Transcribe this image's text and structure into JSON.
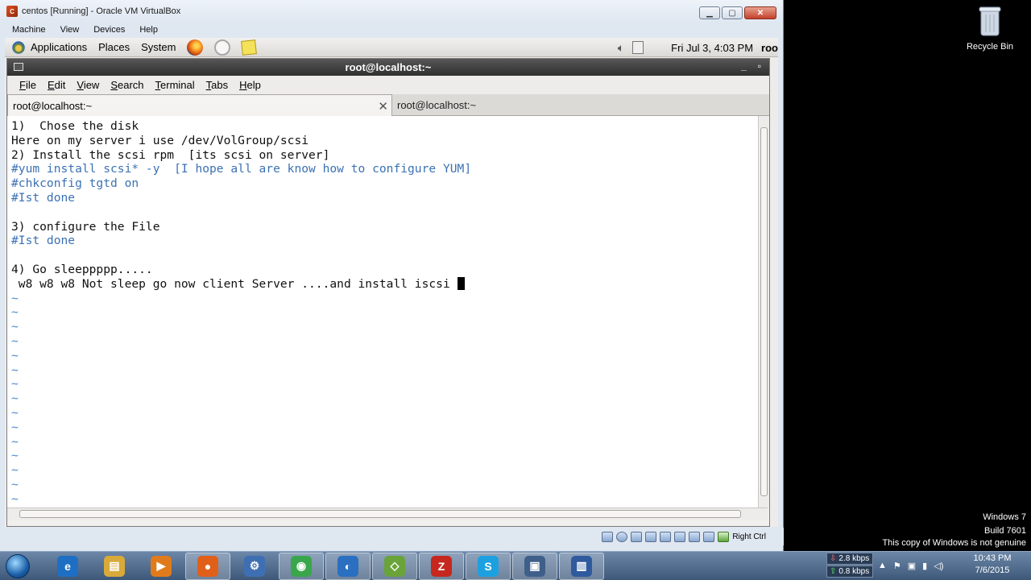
{
  "vbox": {
    "title": "centos [Running] - Oracle VM VirtualBox",
    "menu": [
      "Machine",
      "View",
      "Devices",
      "Help"
    ],
    "status_text": "Right Ctrl"
  },
  "gnome_panel": {
    "applications": "Applications",
    "places": "Places",
    "system": "System",
    "datetime": "Fri Jul  3,  4:03 PM",
    "user": "roo"
  },
  "terminal": {
    "title": "root@localhost:~",
    "menu": [
      {
        "label": "File",
        "u": "F",
        "rest": "ile"
      },
      {
        "label": "Edit",
        "u": "E",
        "rest": "dit"
      },
      {
        "label": "View",
        "u": "V",
        "rest": "iew"
      },
      {
        "label": "Search",
        "u": "S",
        "rest": "earch"
      },
      {
        "label": "Terminal",
        "u": "T",
        "rest": "erminal"
      },
      {
        "label": "Tabs",
        "u": "T",
        "rest": "abs"
      },
      {
        "label": "Help",
        "u": "H",
        "rest": "elp"
      }
    ],
    "tabs": [
      "root@localhost:~",
      "root@localhost:~"
    ],
    "lines": [
      {
        "text": "1)  Chose the disk",
        "style": "black"
      },
      {
        "text": "Here on my server i use /dev/VolGroup/scsi",
        "style": "black"
      },
      {
        "text": "2) Install the scsi rpm  [its scsi on server]",
        "style": "black"
      },
      {
        "text": "#yum install scsi* -y  [I hope all are know how to configure YUM]",
        "style": "blue"
      },
      {
        "text": "#chkconfig tgtd on",
        "style": "blue"
      },
      {
        "text": "#Ist done",
        "style": "blue"
      },
      {
        "text": "",
        "style": "black"
      },
      {
        "text": "3) configure the File",
        "style": "black"
      },
      {
        "text": "#Ist done",
        "style": "blue"
      },
      {
        "text": "",
        "style": "black"
      },
      {
        "text": "4) Go sleeppppp.....",
        "style": "black"
      },
      {
        "text": " w8 w8 w8 Not sleep go now client Server ....and install iscsi ",
        "style": "black",
        "cursor": true
      },
      {
        "text": "~",
        "style": "tilde"
      },
      {
        "text": "~",
        "style": "tilde"
      },
      {
        "text": "~",
        "style": "tilde"
      },
      {
        "text": "~",
        "style": "tilde"
      },
      {
        "text": "~",
        "style": "tilde"
      },
      {
        "text": "~",
        "style": "tilde"
      },
      {
        "text": "~",
        "style": "tilde"
      },
      {
        "text": "~",
        "style": "tilde"
      },
      {
        "text": "~",
        "style": "tilde"
      },
      {
        "text": "~",
        "style": "tilde"
      },
      {
        "text": "~",
        "style": "tilde"
      },
      {
        "text": "~",
        "style": "tilde"
      },
      {
        "text": "~",
        "style": "tilde"
      },
      {
        "text": "~",
        "style": "tilde"
      },
      {
        "text": "~",
        "style": "tilde"
      },
      {
        "text": "~",
        "style": "tilde"
      }
    ]
  },
  "desktop": {
    "recycle_bin": "Recycle Bin",
    "genuine": [
      "Windows 7",
      "Build 7601",
      "This copy of Windows is not genuine"
    ]
  },
  "taskbar": {
    "net_down": "2.8 kbps",
    "net_up": "0.8 kbps",
    "time": "10:43 PM",
    "date": "7/6/2015",
    "apps": [
      {
        "name": "ie-icon",
        "color": "#1e6fc4",
        "glyph": "e"
      },
      {
        "name": "explorer-icon",
        "color": "#d9a93a",
        "glyph": "▤"
      },
      {
        "name": "media-player-icon",
        "color": "#e07b1b",
        "glyph": "▶"
      },
      {
        "name": "firefox-icon",
        "color": "#e0601a",
        "glyph": "●"
      },
      {
        "name": "network-tool-icon",
        "color": "#3f6fb3",
        "glyph": "⚙"
      },
      {
        "name": "chrome-icon",
        "color": "#3aa64c",
        "glyph": "◉"
      },
      {
        "name": "app-blue-icon",
        "color": "#2a6fc0",
        "glyph": "◐"
      },
      {
        "name": "vmware-icon",
        "color": "#6aa33a",
        "glyph": "◇"
      },
      {
        "name": "filezilla-icon",
        "color": "#c6281e",
        "glyph": "Z"
      },
      {
        "name": "skype-icon",
        "color": "#1da0e0",
        "glyph": "S"
      },
      {
        "name": "virtualbox-icon",
        "color": "#3f5f8a",
        "glyph": "▣"
      },
      {
        "name": "video-editor-icon",
        "color": "#2f5a9e",
        "glyph": "▥"
      }
    ]
  }
}
